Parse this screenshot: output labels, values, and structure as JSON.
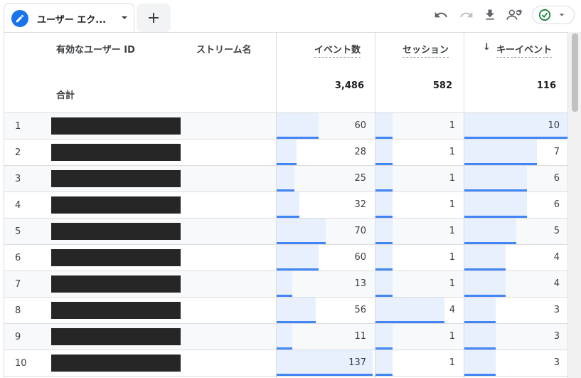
{
  "tab": {
    "label": "ユーザー エク..."
  },
  "toolbar": {
    "icons": [
      "undo-icon",
      "redo-icon",
      "download-icon",
      "share-user-icon",
      "status-check-icon"
    ]
  },
  "columns": {
    "user_id": "有効なユーザー ID",
    "stream": "ストリーム名",
    "events": "イベント数",
    "sessions": "セッション",
    "key_events": "キーイベント",
    "sort_indicator": "↓"
  },
  "totals": {
    "label": "合計",
    "events": "3,486",
    "sessions": "582",
    "key_events": "116"
  },
  "rows": [
    {
      "index": "1",
      "events": "60",
      "sessions": "1",
      "key_events": "10"
    },
    {
      "index": "2",
      "events": "28",
      "sessions": "1",
      "key_events": "7"
    },
    {
      "index": "3",
      "events": "25",
      "sessions": "1",
      "key_events": "6"
    },
    {
      "index": "4",
      "events": "32",
      "sessions": "1",
      "key_events": "6"
    },
    {
      "index": "5",
      "events": "70",
      "sessions": "1",
      "key_events": "5"
    },
    {
      "index": "6",
      "events": "60",
      "sessions": "1",
      "key_events": "4"
    },
    {
      "index": "7",
      "events": "13",
      "sessions": "1",
      "key_events": "4"
    },
    {
      "index": "8",
      "events": "56",
      "sessions": "4",
      "key_events": "3"
    },
    {
      "index": "9",
      "events": "11",
      "sessions": "1",
      "key_events": "3"
    },
    {
      "index": "10",
      "events": "137",
      "sessions": "1",
      "key_events": "3"
    }
  ],
  "colors": {
    "accent": "#1a73e8",
    "bar": "#4285f4",
    "bar_bg": "#e8f0fe",
    "ok": "#188038"
  }
}
